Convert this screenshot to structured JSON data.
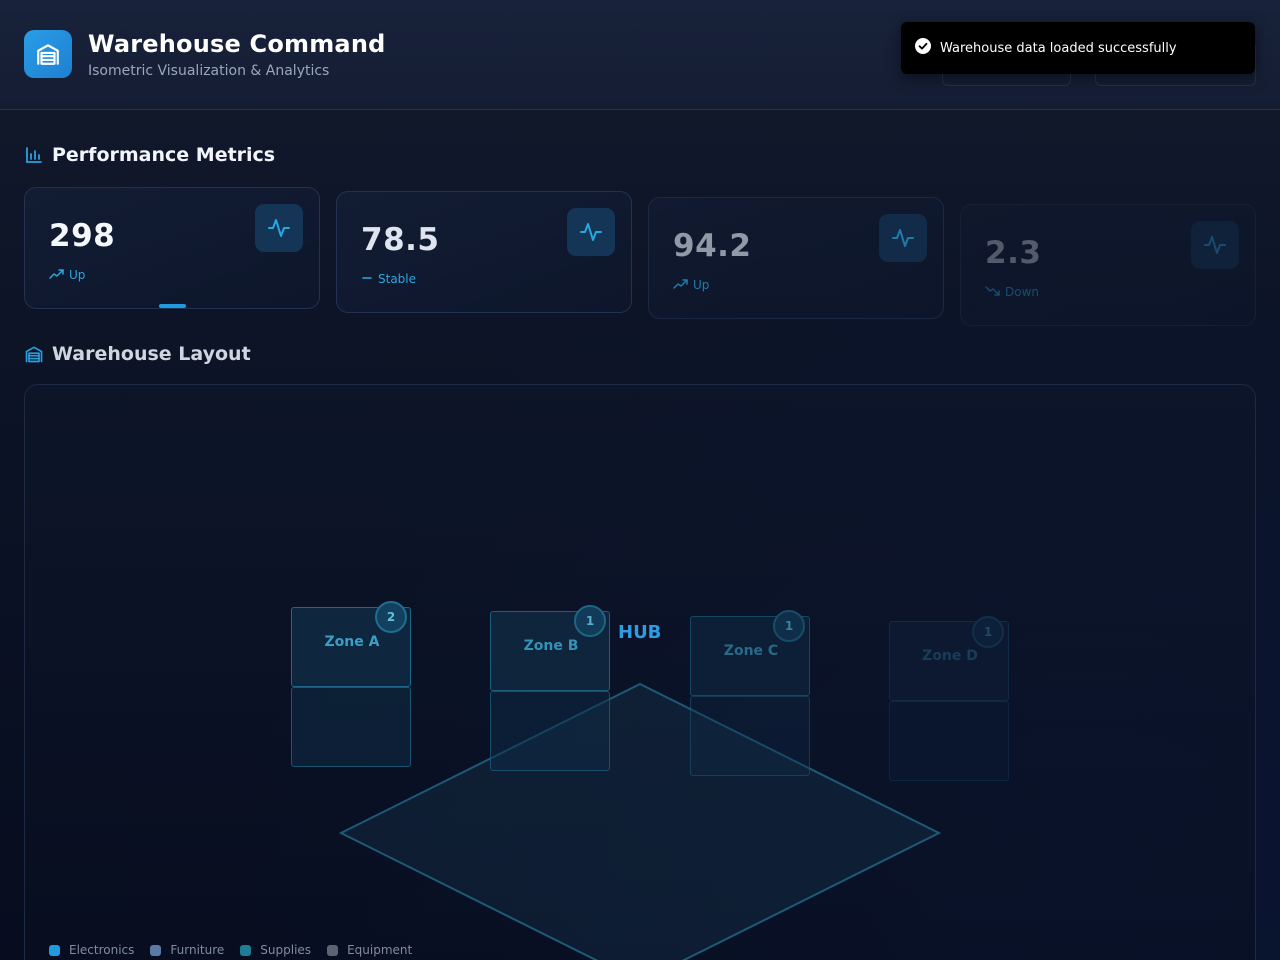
{
  "header": {
    "title": "Warehouse Command",
    "subtitle": "Isometric Visualization & Analytics",
    "logo_icon": "warehouse-icon",
    "ghost_value": "298"
  },
  "toast": {
    "message": "Warehouse data loaded successfully",
    "icon": "check-circle-icon"
  },
  "metrics_section": {
    "title": "Performance Metrics",
    "icon": "bar-chart-icon",
    "cards": [
      {
        "value": "298",
        "trend": "Up",
        "trend_icon": "trending-up-icon"
      },
      {
        "value": "78.5",
        "trend": "Stable",
        "trend_icon": "minus-icon"
      },
      {
        "value": "94.2",
        "trend": "Up",
        "trend_icon": "trending-up-icon"
      },
      {
        "value": "2.3",
        "trend": "Down",
        "trend_icon": "trending-down-icon"
      }
    ]
  },
  "layout_section": {
    "title": "Warehouse Layout",
    "icon": "warehouse-icon",
    "hub_label": "HUB",
    "zones": [
      {
        "label": "Zone A",
        "count": "2"
      },
      {
        "label": "Zone B",
        "count": "1"
      },
      {
        "label": "Zone C",
        "count": "1"
      },
      {
        "label": "Zone D",
        "count": "1"
      }
    ],
    "legend": [
      {
        "label": "Electronics",
        "color": "#1f9be0"
      },
      {
        "label": "Furniture",
        "color": "#5c7aa6"
      },
      {
        "label": "Supplies",
        "color": "#1d7f94"
      },
      {
        "label": "Equipment",
        "color": "#5b6472"
      }
    ]
  },
  "colors": {
    "accent": "#1f9be0",
    "background": "#0b1224",
    "zone_border": "#1f6688"
  }
}
